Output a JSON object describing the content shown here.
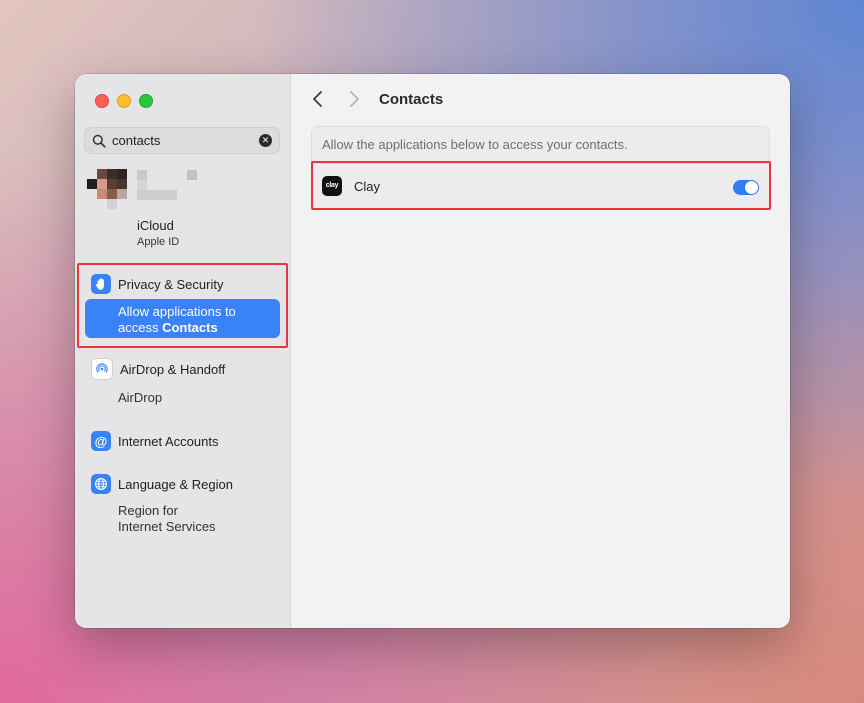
{
  "window": {
    "traffic_lights": [
      "close",
      "minimize",
      "zoom"
    ]
  },
  "sidebar": {
    "search": {
      "value": "contacts",
      "icon": "magnifier-icon",
      "clear_icon": "clear-search-icon"
    },
    "account": {
      "name_redacted": true,
      "service": "iCloud",
      "subtitle": "Apple ID"
    },
    "items": [
      {
        "label": "Privacy & Security",
        "icon": "hand-raised-icon",
        "color": "#3a82f7",
        "sub": {
          "line1": "Allow applications to",
          "line2_prefix": "access ",
          "line2_bold": "Contacts"
        }
      },
      {
        "label": "AirDrop & Handoff",
        "icon": "airdrop-icon",
        "color": "#ffffff",
        "sub": {
          "line1": "AirDrop"
        }
      },
      {
        "label": "Internet Accounts",
        "icon": "at-sign-icon",
        "color": "#3a82f7"
      },
      {
        "label": "Language & Region",
        "icon": "globe-icon",
        "color": "#3a82f7",
        "sub": {
          "line1": "Region for",
          "line2": "Internet Services"
        }
      }
    ],
    "selected_color": "#3a82f7"
  },
  "main": {
    "title": "Contacts",
    "description": "Allow the applications below to access your contacts.",
    "apps": [
      {
        "name": "Clay",
        "icon_text": "clay",
        "enabled": true
      }
    ],
    "toggle_color": "#2f7cf6"
  },
  "highlight_color": "#e5383b"
}
